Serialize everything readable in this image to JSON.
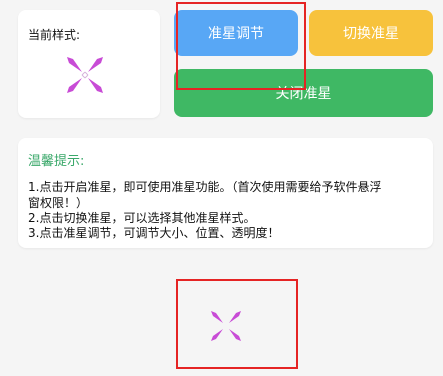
{
  "style_panel": {
    "label": "当前样式:"
  },
  "buttons": {
    "adjust": "准星调节",
    "switch": "切换准星",
    "close": "关闭准星"
  },
  "tips": {
    "title": "温馨提示:",
    "lines": [
      "1.点击开启准星，即可使用准星功能。（首次使用需要给予软件悬浮",
      "窗权限！）",
      "2.点击切换准星，可以选择其他准星样式。",
      "3.点击准星调节，可调节大小、位置、透明度！"
    ]
  },
  "colors": {
    "adjust_button": "#58a7f5",
    "switch_button": "#f7c23c",
    "close_button": "#3fb864",
    "crosshair": "#c84bd6",
    "highlight": "#e52424",
    "tips_title": "#3aa86a"
  },
  "icons": {
    "crosshair_preview": "crosshair-icon"
  }
}
